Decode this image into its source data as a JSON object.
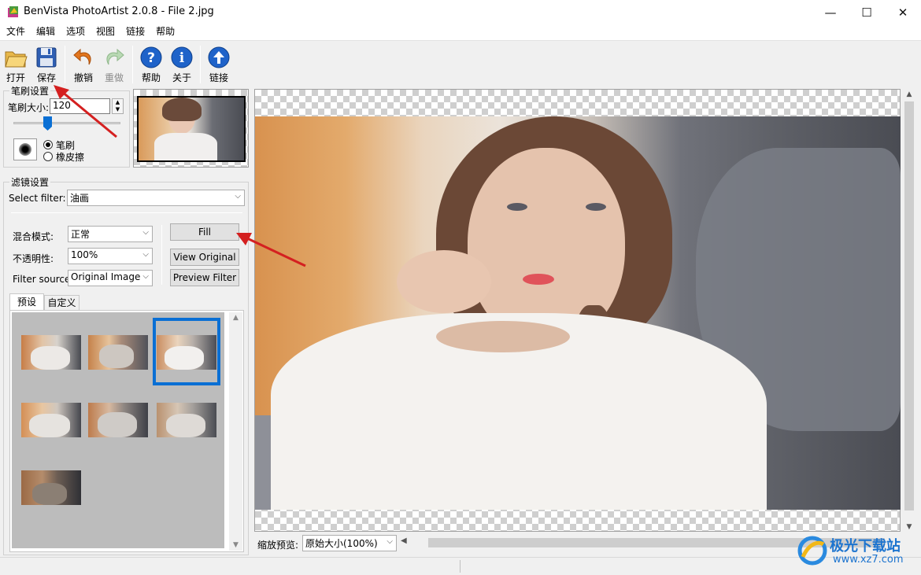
{
  "window": {
    "title": "BenVista PhotoArtist 2.0.8 - File 2.jpg",
    "minimize": "—",
    "maximize": "☐",
    "close": "✕"
  },
  "menu": [
    "文件",
    "编辑",
    "选项",
    "视图",
    "链接",
    "帮助"
  ],
  "toolbar": {
    "open": "打开",
    "save": "保存",
    "undo": "撤销",
    "redo": "重做",
    "help": "帮助",
    "about": "关于",
    "link": "链接"
  },
  "brush": {
    "group_label": "笔刷设置",
    "size_label": "笔刷大小:",
    "size_value": "120",
    "brush_option": "笔刷",
    "eraser_option": "橡皮擦",
    "selected": "笔刷"
  },
  "filter": {
    "group_label": "滤镜设置",
    "select_label": "Select filter:",
    "select_value": "油画",
    "blend_label": "混合模式:",
    "blend_value": "正常",
    "opacity_label": "不透明性:",
    "opacity_value": "100%",
    "source_label": "Filter source:",
    "source_value": "Original Image",
    "fill_button": "Fill",
    "view_original_button": "View Original",
    "preview_filter_button": "Preview Filter",
    "tabs": [
      "预设",
      "自定义"
    ],
    "active_tab": "预设",
    "selected_preset_index": 2
  },
  "zoom": {
    "label": "缩放预览:",
    "value": "原始大小(100%)"
  },
  "watermark": {
    "name": "极光下载站",
    "url": "www.xz7.com"
  },
  "colors": {
    "accent": "#0a6fd4",
    "arrow": "#d42020"
  }
}
